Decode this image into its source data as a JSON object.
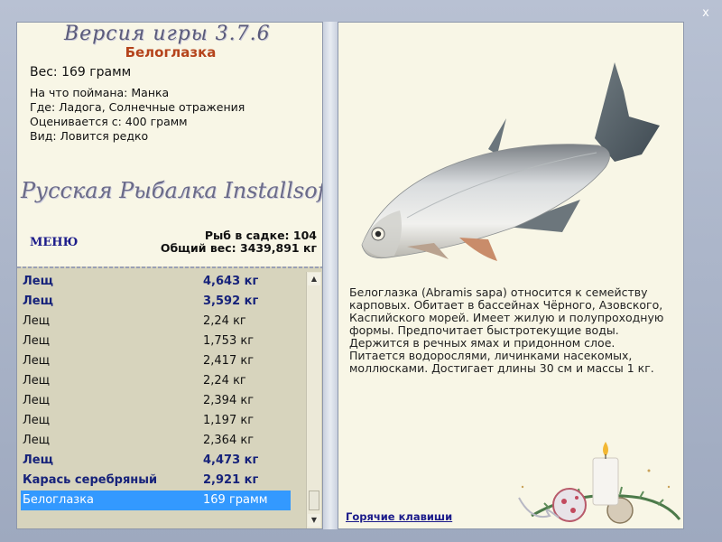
{
  "window": {
    "close_label": "x"
  },
  "left": {
    "version_title": "Версия игры   3.7.6",
    "fish_name": "Белоглазка",
    "weight": "Вес: 169 грамм",
    "info": [
      "На что поймана: Манка",
      "Где: Ладога, Солнечные отражения",
      "Оценивается с: 400 грамм",
      "Вид: Ловится редко"
    ],
    "brand": "Русская Рыбалка Installsoft",
    "menu_label": "МЕНЮ",
    "stats": {
      "count": "Рыб в садке: 104",
      "total": "Общий вес: 3439,891 кг"
    }
  },
  "catch_list": [
    {
      "name": "Лещ",
      "weight": "4,643 кг"
    },
    {
      "name": "Лещ",
      "weight": "3,592 кг"
    },
    {
      "name": "Лещ",
      "weight": "2,24 кг"
    },
    {
      "name": "Лещ",
      "weight": "1,753 кг"
    },
    {
      "name": "Лещ",
      "weight": "2,417 кг"
    },
    {
      "name": "Лещ",
      "weight": "2,24 кг"
    },
    {
      "name": "Лещ",
      "weight": "2,394 кг"
    },
    {
      "name": "Лещ",
      "weight": "1,197 кг"
    },
    {
      "name": "Лещ",
      "weight": "2,364 кг"
    },
    {
      "name": "Лещ",
      "weight": "4,473 кг"
    },
    {
      "name": "Карась серебряный",
      "weight": "2,921 кг"
    },
    {
      "name": "Белоглазка",
      "weight": "169 грамм"
    }
  ],
  "scrollbar": {
    "up_icon": "arrow-up-icon",
    "down_icon": "arrow-down-icon"
  },
  "right": {
    "image_icon": "fish-illustration",
    "description": "Белоглазка (Abramis sapa) относится к семейству карповых. Обитает в бассейнах Чёрного, Азовского, Каспийского морей. Имеет жилую и полупроходную формы. Предпочитает быстротекущие воды. Держится в речных ямах и придонном слое. Питается водорослями, личинками насекомых, моллюсками. Достигает длины 30 см и массы 1 кг.",
    "hotkeys_label": "Горячие клавиши",
    "decoration_icon": "christmas-candle-decoration"
  },
  "colors": {
    "bg": "#f8f6e6",
    "list_bg": "#d7d4bd",
    "selected": "#3399ff",
    "bold_row": "#16227a",
    "fish_name": "#b5441c"
  }
}
